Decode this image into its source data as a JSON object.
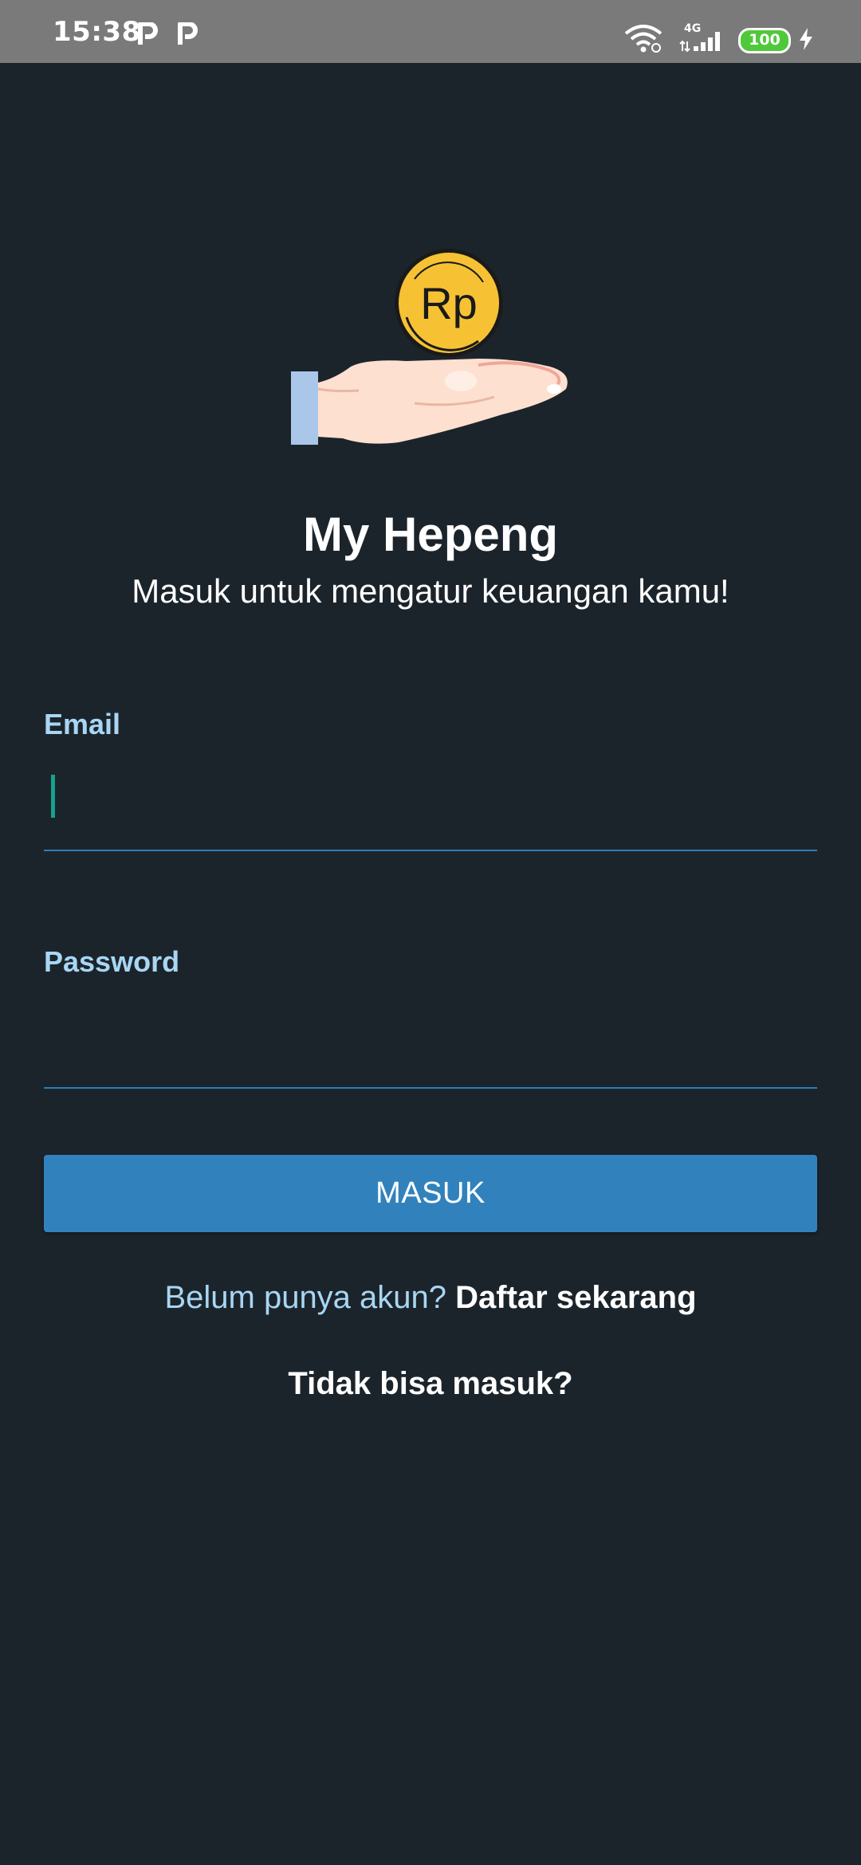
{
  "status_bar": {
    "time": "15:38",
    "notification_icons": [
      "p-icon",
      "p-icon"
    ],
    "network": "4G",
    "battery": "100"
  },
  "app": {
    "title": "My Hepeng",
    "subtitle": "Masuk untuk mengatur keuangan kamu!",
    "logo_text": "Rp"
  },
  "form": {
    "email_label": "Email",
    "email_value": "",
    "password_label": "Password",
    "password_value": "",
    "submit_label": "MASUK"
  },
  "links": {
    "signup_question": "Belum punya akun?",
    "signup_action": "Daftar sekarang",
    "forgot": "Tidak bisa masuk?"
  },
  "colors": {
    "background": "#1c242b",
    "accent": "#3182bc",
    "label": "#a8d6f4",
    "cursor": "#17a18e"
  }
}
